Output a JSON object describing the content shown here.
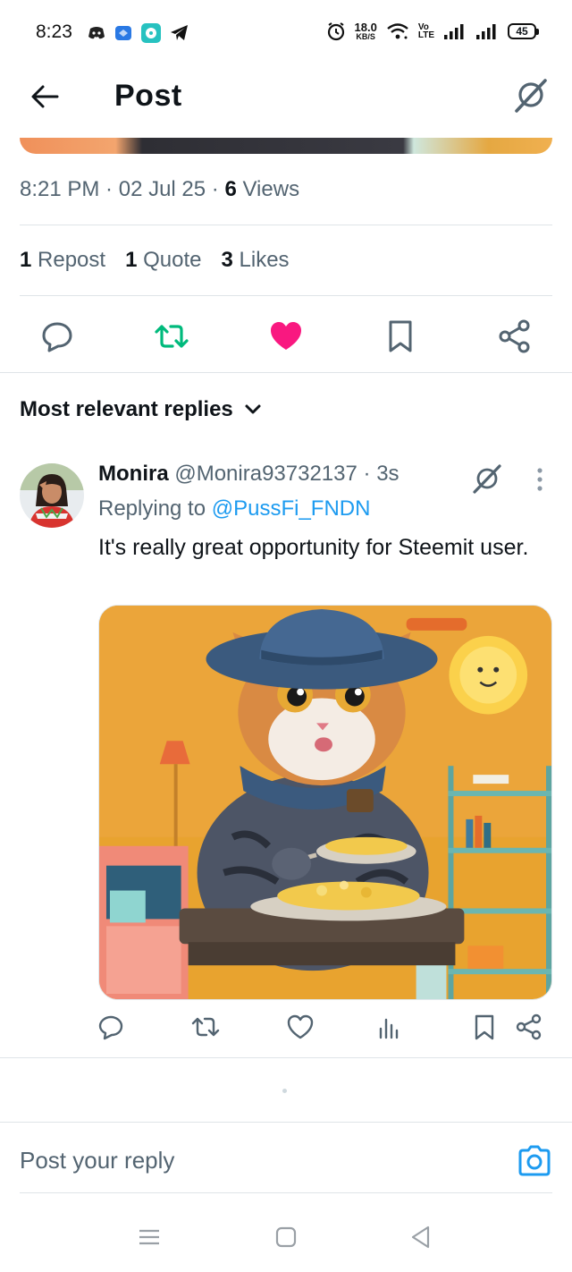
{
  "status_bar": {
    "time": "8:23",
    "net_speed_value": "18.0",
    "net_speed_unit": "KB/S",
    "volte_top": "Vo",
    "volte_bottom": "LTE",
    "battery": "45"
  },
  "header": {
    "title": "Post"
  },
  "post_meta": {
    "time": "8:21 PM",
    "sep1": " · ",
    "date": "02 Jul 25",
    "sep2": " · ",
    "views_count": "6",
    "views_label": " Views"
  },
  "stats": {
    "reposts_count": "1",
    "reposts_label": " Repost",
    "quotes_count": "1",
    "quotes_label": " Quote",
    "likes_count": "3",
    "likes_label": " Likes"
  },
  "colors": {
    "retweet_green": "#00ba7c",
    "like_pink": "#f91880",
    "link_blue": "#1d9bf0",
    "muted_gray": "#536471"
  },
  "replies_filter": {
    "label": "Most relevant replies"
  },
  "reply": {
    "name": "Monira",
    "handle": "@Monira93732137",
    "time_sep": " · ",
    "time": "3s",
    "replying_prefix": "Replying to ",
    "replying_to": "@PussFi_FNDN",
    "text": "It's really great opportunity for Steemit user."
  },
  "compose": {
    "placeholder": "Post your reply"
  },
  "icons": {
    "status_apps": [
      "discord-icon",
      "bluesky-icon",
      "chat-app-icon",
      "telegram-icon"
    ],
    "status_system": [
      "alarm-icon",
      "wifi-icon",
      "signal-icon",
      "signal-icon",
      "battery-icon"
    ],
    "post_actions": [
      "reply-icon",
      "retweet-icon",
      "like-icon-filled",
      "bookmark-icon",
      "share-icon"
    ],
    "reply_actions": [
      "reply-icon",
      "retweet-icon",
      "like-icon",
      "views-icon",
      "bookmark-icon",
      "share-icon"
    ],
    "navbar": [
      "menu-icon",
      "home-icon",
      "back-icon"
    ]
  }
}
